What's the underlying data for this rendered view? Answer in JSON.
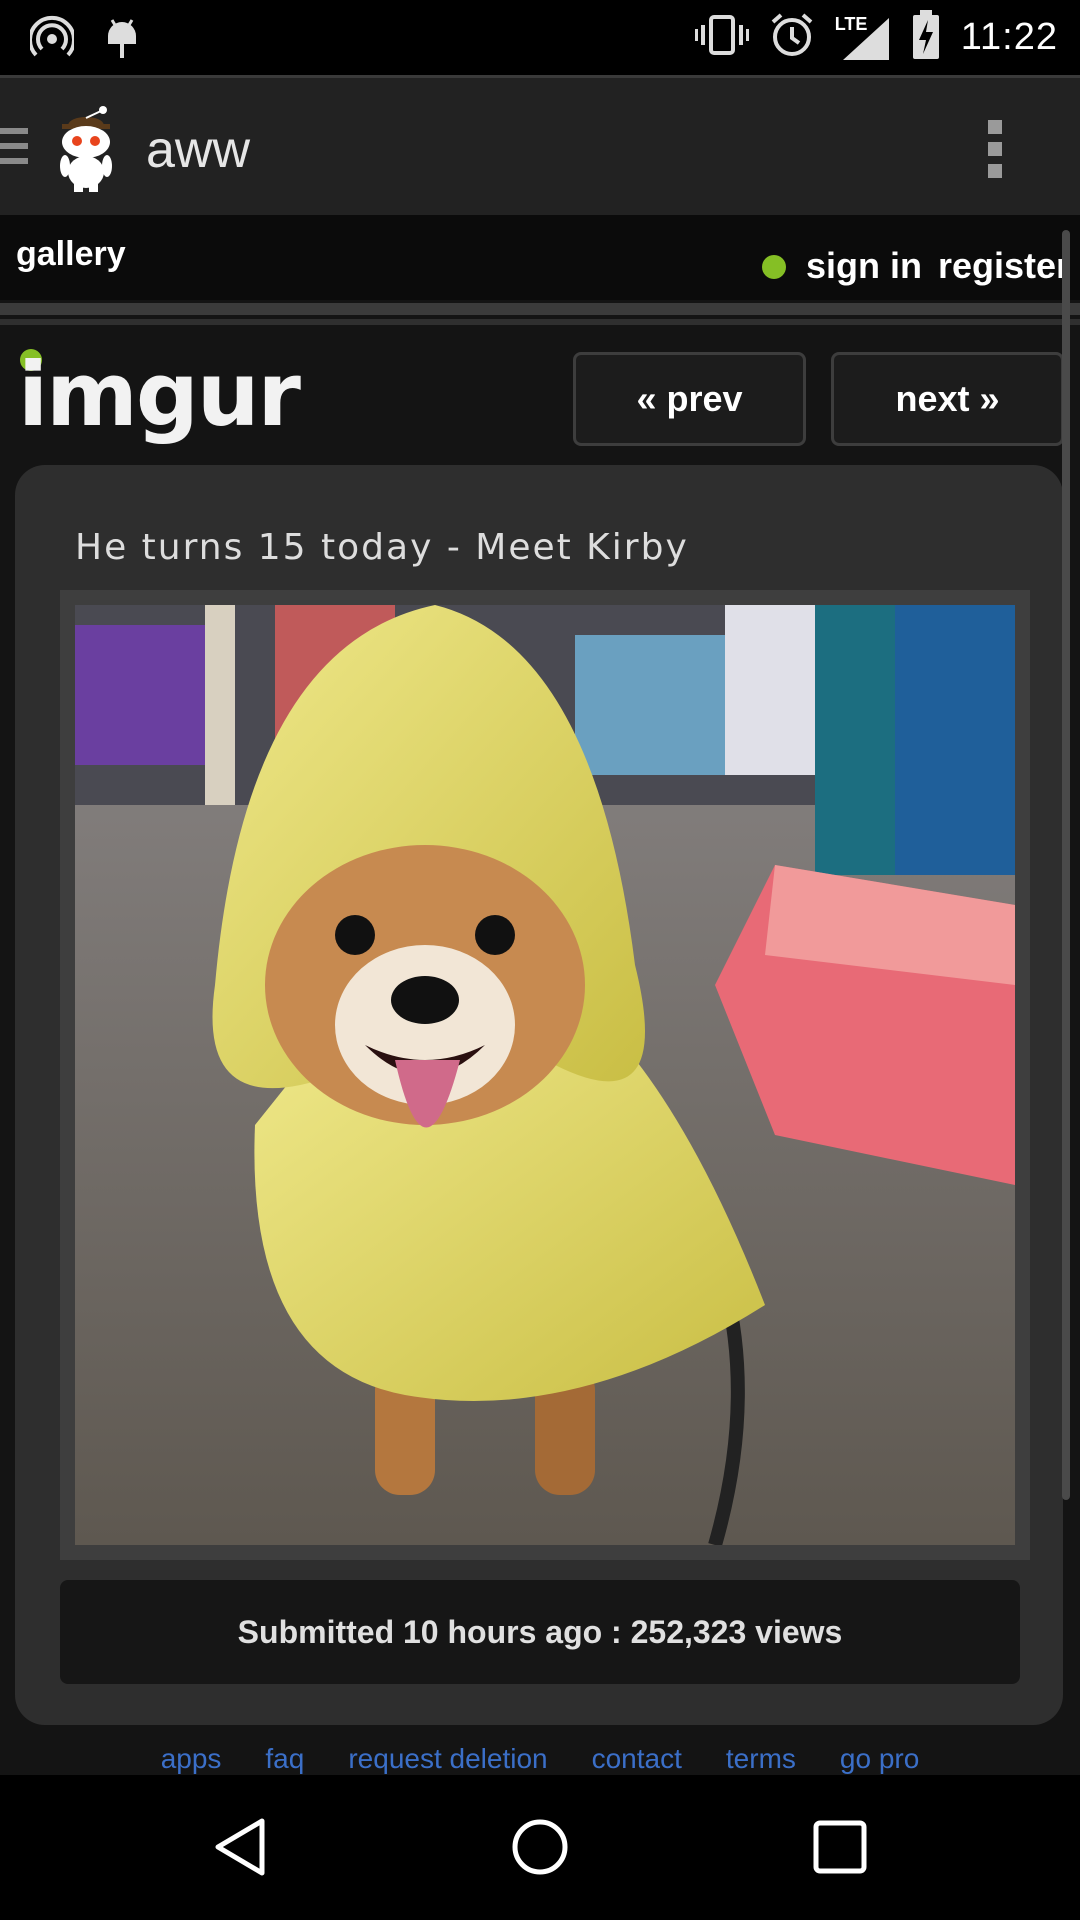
{
  "status_bar": {
    "time": "11:22",
    "network": "LTE",
    "icons": [
      "hotspot-icon",
      "android-debug-icon",
      "vibrate-icon",
      "alarm-icon",
      "lte-signal-icon",
      "battery-charging-icon"
    ]
  },
  "app_bar": {
    "title": "aww",
    "icons": [
      "menu-icon",
      "reddit-alien-icon",
      "overflow-menu-icon"
    ]
  },
  "site_nav": {
    "gallery_label": "gallery",
    "sign_in_label": "sign in",
    "register_label": "register"
  },
  "imgur": {
    "logo_text": "imgur",
    "prev_label": "« prev",
    "next_label": "next »"
  },
  "post": {
    "title": "He turns 15 today - Meet Kirby",
    "meta": "Submitted 10 hours ago : 252,323 views"
  },
  "footer_links": [
    "apps",
    "faq",
    "request deletion",
    "contact",
    "terms",
    "go pro"
  ],
  "colors": {
    "imgur_green": "#85bf25",
    "link_blue": "#3b6fc8",
    "raincoat_yellow": "#e8e06a"
  }
}
